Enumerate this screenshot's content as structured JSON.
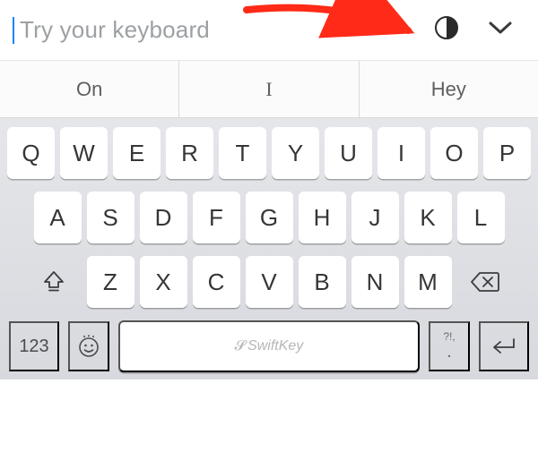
{
  "header": {
    "placeholder": "Try your keyboard",
    "theme_icon": "contrast-icon",
    "collapse_icon": "chevron-down-icon"
  },
  "annotation": {
    "arrow_color": "#ff2a17"
  },
  "suggestions": [
    "On",
    "I",
    "Hey"
  ],
  "keyboard": {
    "row1": [
      "Q",
      "W",
      "E",
      "R",
      "T",
      "Y",
      "U",
      "I",
      "O",
      "P"
    ],
    "row2": [
      "A",
      "S",
      "D",
      "F",
      "G",
      "H",
      "J",
      "K",
      "L"
    ],
    "row3": [
      "Z",
      "X",
      "C",
      "V",
      "B",
      "N",
      "M"
    ],
    "numeric_label": "123",
    "space_brand": "SwiftKey",
    "punctuation_hint": "?!,",
    "punctuation_main": "."
  }
}
